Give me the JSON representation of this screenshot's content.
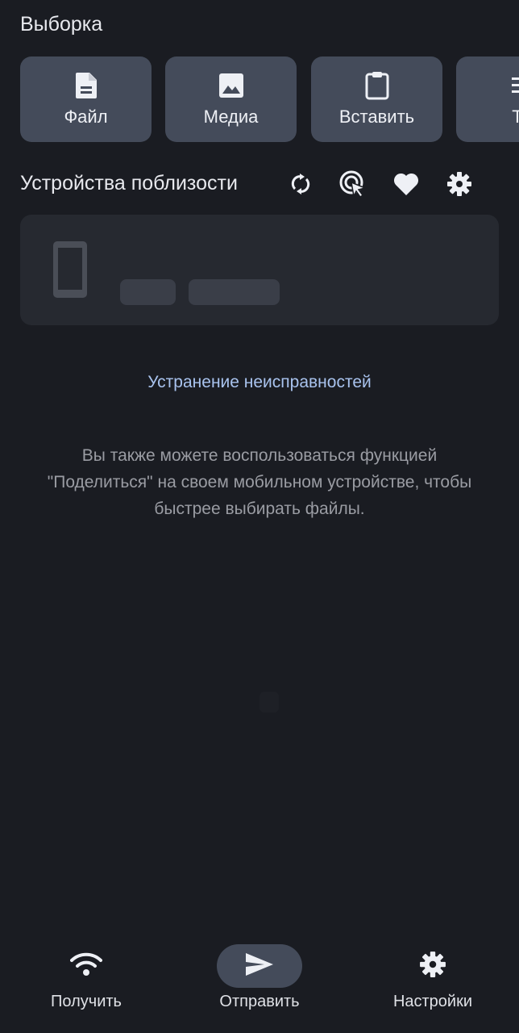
{
  "selection": {
    "title": "Выборка",
    "buttons": [
      {
        "label": "Файл",
        "icon": "file-icon"
      },
      {
        "label": "Медиа",
        "icon": "image-icon"
      },
      {
        "label": "Вставить",
        "icon": "clipboard-icon"
      },
      {
        "label": "Те",
        "icon": "text-icon"
      }
    ]
  },
  "nearby": {
    "title": "Устройства поблизости",
    "actions": [
      "refresh-icon",
      "target-click-icon",
      "heart-icon",
      "gear-icon"
    ]
  },
  "troubleshoot_label": "Устранение неисправностей",
  "hint_text": "Вы также можете воспользоваться функцией \"Поделиться\" на своем мобильном устройстве, чтобы быстрее выбирать файлы.",
  "bottom_nav": {
    "items": [
      {
        "label": "Получить",
        "icon": "wifi-icon",
        "active": false
      },
      {
        "label": "Отправить",
        "icon": "send-icon",
        "active": true
      },
      {
        "label": "Настройки",
        "icon": "gear-icon",
        "active": false
      }
    ]
  },
  "colors": {
    "background": "#1a1c22",
    "button": "#444b5a",
    "card": "#262930",
    "link": "#a9c3ee"
  }
}
